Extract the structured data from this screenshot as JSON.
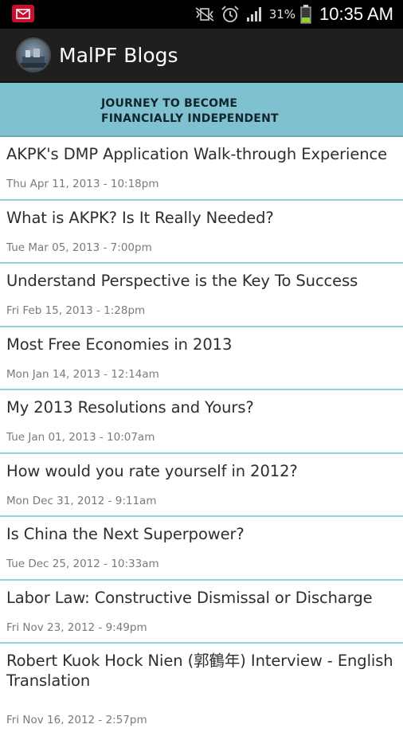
{
  "status_bar": {
    "battery_percent": "31%",
    "time": "10:35 AM",
    "icons": [
      "mail-icon",
      "mute-vibrate-icon",
      "alarm-icon",
      "signal-icon",
      "battery-icon"
    ]
  },
  "action_bar": {
    "title": "MalPF Blogs",
    "logo_icon": "app-logo-icon"
  },
  "banner": {
    "line1": "JOURNEY TO BECOME",
    "line2": "FINANCIALLY INDEPENDENT"
  },
  "posts": [
    {
      "title": "AKPK's DMP Application Walk-through Experience",
      "date": "Thu Apr 11, 2013 - 10:18pm"
    },
    {
      "title": "What is AKPK? Is It Really Needed?",
      "date": "Tue Mar 05, 2013 - 7:00pm"
    },
    {
      "title": "Understand Perspective is the Key To Success",
      "date": "Fri Feb 15, 2013 - 1:28pm"
    },
    {
      "title": "Most Free Economies in 2013",
      "date": "Mon Jan 14, 2013 - 12:14am"
    },
    {
      "title": "My 2013 Resolutions and Yours?",
      "date": "Tue Jan 01, 2013 - 10:07am"
    },
    {
      "title": "How would you rate yourself in 2012?",
      "date": "Mon Dec 31, 2012 - 9:11am"
    },
    {
      "title": "Is China the Next Superpower?",
      "date": "Tue Dec 25, 2012 - 10:33am"
    },
    {
      "title": "Labor Law: Constructive Dismissal or Discharge",
      "date": "Fri Nov 23, 2012 - 9:49pm"
    },
    {
      "title": "Robert Kuok Hock Nien (郭鶴年) Interview - English Translation",
      "date": "Fri Nov 16, 2012 - 2:57pm"
    }
  ],
  "colors": {
    "banner": "#7fc1d0",
    "divider": "#99d0de",
    "action_bar": "#1f1f1f",
    "status_bar": "#000000"
  }
}
